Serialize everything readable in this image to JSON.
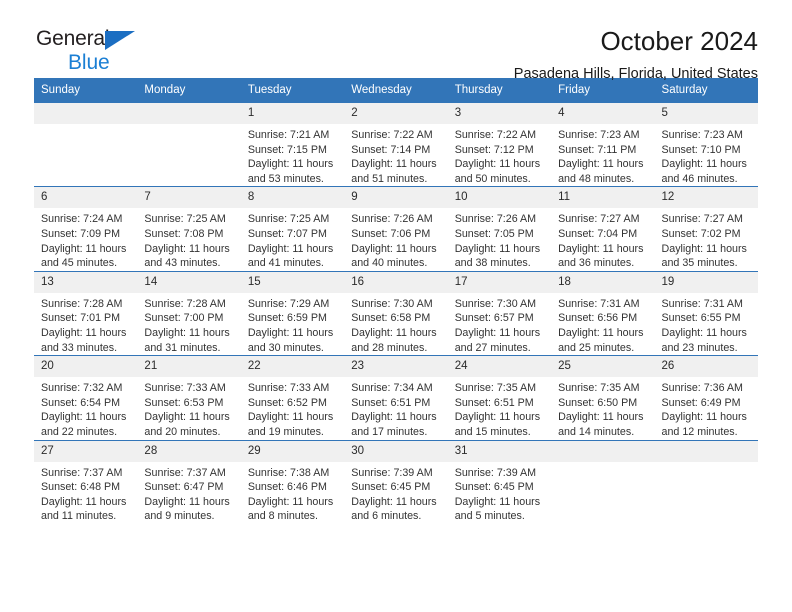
{
  "brand": {
    "name_part1": "General",
    "name_part2": "Blue",
    "triangle_icon": "triangle-icon",
    "accent_color": "#1b6ec2",
    "secondary_color": "#1b7fd4"
  },
  "header": {
    "title": "October 2024",
    "location": "Pasadena Hills, Florida, United States"
  },
  "theme": {
    "header_bg": "#3275b8",
    "daynum_bg": "#f0f0f0",
    "row_divider": "#3275b8",
    "text": "#333333"
  },
  "weekdays": [
    "Sunday",
    "Monday",
    "Tuesday",
    "Wednesday",
    "Thursday",
    "Friday",
    "Saturday"
  ],
  "weeks": [
    [
      {
        "day": "",
        "sunrise": "",
        "sunset": "",
        "daylight1": "",
        "daylight2": "",
        "blank": true
      },
      {
        "day": "",
        "sunrise": "",
        "sunset": "",
        "daylight1": "",
        "daylight2": "",
        "blank": true
      },
      {
        "day": "1",
        "sunrise": "Sunrise: 7:21 AM",
        "sunset": "Sunset: 7:15 PM",
        "daylight1": "Daylight: 11 hours",
        "daylight2": "and 53 minutes."
      },
      {
        "day": "2",
        "sunrise": "Sunrise: 7:22 AM",
        "sunset": "Sunset: 7:14 PM",
        "daylight1": "Daylight: 11 hours",
        "daylight2": "and 51 minutes."
      },
      {
        "day": "3",
        "sunrise": "Sunrise: 7:22 AM",
        "sunset": "Sunset: 7:12 PM",
        "daylight1": "Daylight: 11 hours",
        "daylight2": "and 50 minutes."
      },
      {
        "day": "4",
        "sunrise": "Sunrise: 7:23 AM",
        "sunset": "Sunset: 7:11 PM",
        "daylight1": "Daylight: 11 hours",
        "daylight2": "and 48 minutes."
      },
      {
        "day": "5",
        "sunrise": "Sunrise: 7:23 AM",
        "sunset": "Sunset: 7:10 PM",
        "daylight1": "Daylight: 11 hours",
        "daylight2": "and 46 minutes."
      }
    ],
    [
      {
        "day": "6",
        "sunrise": "Sunrise: 7:24 AM",
        "sunset": "Sunset: 7:09 PM",
        "daylight1": "Daylight: 11 hours",
        "daylight2": "and 45 minutes."
      },
      {
        "day": "7",
        "sunrise": "Sunrise: 7:25 AM",
        "sunset": "Sunset: 7:08 PM",
        "daylight1": "Daylight: 11 hours",
        "daylight2": "and 43 minutes."
      },
      {
        "day": "8",
        "sunrise": "Sunrise: 7:25 AM",
        "sunset": "Sunset: 7:07 PM",
        "daylight1": "Daylight: 11 hours",
        "daylight2": "and 41 minutes."
      },
      {
        "day": "9",
        "sunrise": "Sunrise: 7:26 AM",
        "sunset": "Sunset: 7:06 PM",
        "daylight1": "Daylight: 11 hours",
        "daylight2": "and 40 minutes."
      },
      {
        "day": "10",
        "sunrise": "Sunrise: 7:26 AM",
        "sunset": "Sunset: 7:05 PM",
        "daylight1": "Daylight: 11 hours",
        "daylight2": "and 38 minutes."
      },
      {
        "day": "11",
        "sunrise": "Sunrise: 7:27 AM",
        "sunset": "Sunset: 7:04 PM",
        "daylight1": "Daylight: 11 hours",
        "daylight2": "and 36 minutes."
      },
      {
        "day": "12",
        "sunrise": "Sunrise: 7:27 AM",
        "sunset": "Sunset: 7:02 PM",
        "daylight1": "Daylight: 11 hours",
        "daylight2": "and 35 minutes."
      }
    ],
    [
      {
        "day": "13",
        "sunrise": "Sunrise: 7:28 AM",
        "sunset": "Sunset: 7:01 PM",
        "daylight1": "Daylight: 11 hours",
        "daylight2": "and 33 minutes."
      },
      {
        "day": "14",
        "sunrise": "Sunrise: 7:28 AM",
        "sunset": "Sunset: 7:00 PM",
        "daylight1": "Daylight: 11 hours",
        "daylight2": "and 31 minutes."
      },
      {
        "day": "15",
        "sunrise": "Sunrise: 7:29 AM",
        "sunset": "Sunset: 6:59 PM",
        "daylight1": "Daylight: 11 hours",
        "daylight2": "and 30 minutes."
      },
      {
        "day": "16",
        "sunrise": "Sunrise: 7:30 AM",
        "sunset": "Sunset: 6:58 PM",
        "daylight1": "Daylight: 11 hours",
        "daylight2": "and 28 minutes."
      },
      {
        "day": "17",
        "sunrise": "Sunrise: 7:30 AM",
        "sunset": "Sunset: 6:57 PM",
        "daylight1": "Daylight: 11 hours",
        "daylight2": "and 27 minutes."
      },
      {
        "day": "18",
        "sunrise": "Sunrise: 7:31 AM",
        "sunset": "Sunset: 6:56 PM",
        "daylight1": "Daylight: 11 hours",
        "daylight2": "and 25 minutes."
      },
      {
        "day": "19",
        "sunrise": "Sunrise: 7:31 AM",
        "sunset": "Sunset: 6:55 PM",
        "daylight1": "Daylight: 11 hours",
        "daylight2": "and 23 minutes."
      }
    ],
    [
      {
        "day": "20",
        "sunrise": "Sunrise: 7:32 AM",
        "sunset": "Sunset: 6:54 PM",
        "daylight1": "Daylight: 11 hours",
        "daylight2": "and 22 minutes."
      },
      {
        "day": "21",
        "sunrise": "Sunrise: 7:33 AM",
        "sunset": "Sunset: 6:53 PM",
        "daylight1": "Daylight: 11 hours",
        "daylight2": "and 20 minutes."
      },
      {
        "day": "22",
        "sunrise": "Sunrise: 7:33 AM",
        "sunset": "Sunset: 6:52 PM",
        "daylight1": "Daylight: 11 hours",
        "daylight2": "and 19 minutes."
      },
      {
        "day": "23",
        "sunrise": "Sunrise: 7:34 AM",
        "sunset": "Sunset: 6:51 PM",
        "daylight1": "Daylight: 11 hours",
        "daylight2": "and 17 minutes."
      },
      {
        "day": "24",
        "sunrise": "Sunrise: 7:35 AM",
        "sunset": "Sunset: 6:51 PM",
        "daylight1": "Daylight: 11 hours",
        "daylight2": "and 15 minutes."
      },
      {
        "day": "25",
        "sunrise": "Sunrise: 7:35 AM",
        "sunset": "Sunset: 6:50 PM",
        "daylight1": "Daylight: 11 hours",
        "daylight2": "and 14 minutes."
      },
      {
        "day": "26",
        "sunrise": "Sunrise: 7:36 AM",
        "sunset": "Sunset: 6:49 PM",
        "daylight1": "Daylight: 11 hours",
        "daylight2": "and 12 minutes."
      }
    ],
    [
      {
        "day": "27",
        "sunrise": "Sunrise: 7:37 AM",
        "sunset": "Sunset: 6:48 PM",
        "daylight1": "Daylight: 11 hours",
        "daylight2": "and 11 minutes."
      },
      {
        "day": "28",
        "sunrise": "Sunrise: 7:37 AM",
        "sunset": "Sunset: 6:47 PM",
        "daylight1": "Daylight: 11 hours",
        "daylight2": "and 9 minutes."
      },
      {
        "day": "29",
        "sunrise": "Sunrise: 7:38 AM",
        "sunset": "Sunset: 6:46 PM",
        "daylight1": "Daylight: 11 hours",
        "daylight2": "and 8 minutes."
      },
      {
        "day": "30",
        "sunrise": "Sunrise: 7:39 AM",
        "sunset": "Sunset: 6:45 PM",
        "daylight1": "Daylight: 11 hours",
        "daylight2": "and 6 minutes."
      },
      {
        "day": "31",
        "sunrise": "Sunrise: 7:39 AM",
        "sunset": "Sunset: 6:45 PM",
        "daylight1": "Daylight: 11 hours",
        "daylight2": "and 5 minutes."
      },
      {
        "day": "",
        "sunrise": "",
        "sunset": "",
        "daylight1": "",
        "daylight2": "",
        "blank": true
      },
      {
        "day": "",
        "sunrise": "",
        "sunset": "",
        "daylight1": "",
        "daylight2": "",
        "blank": true
      }
    ]
  ]
}
